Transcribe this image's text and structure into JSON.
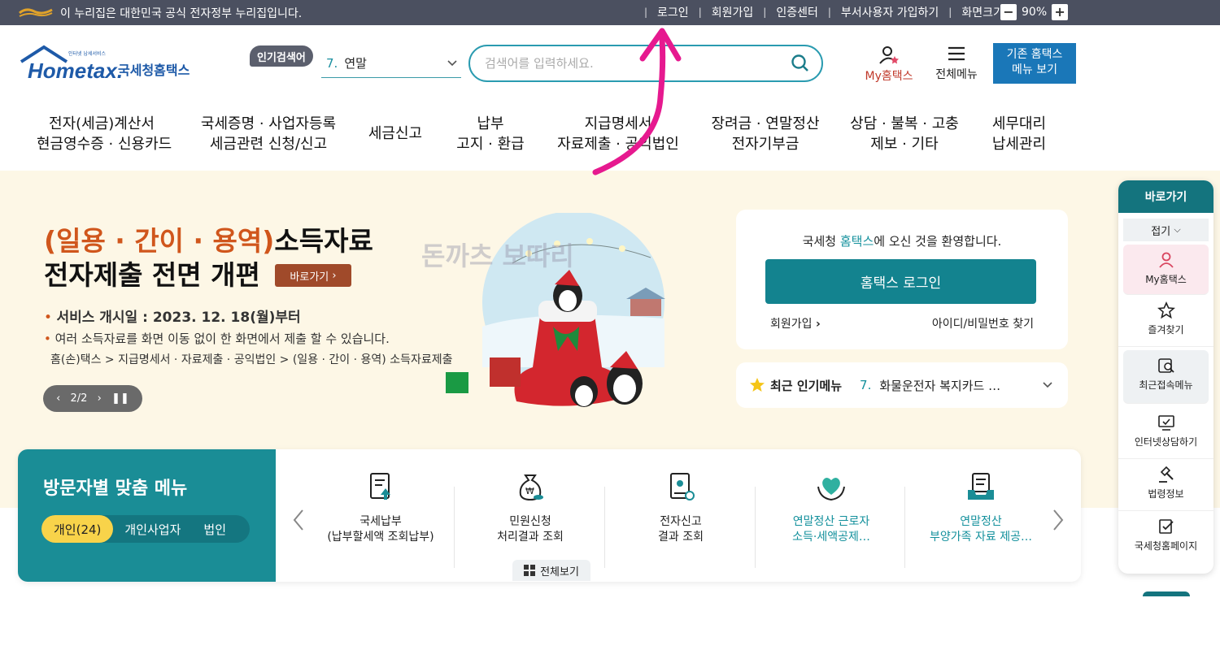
{
  "gov_bar": {
    "notice": "이 누리집은 대한민국 공식 전자정부 누리집입니다.",
    "links": [
      "로그인",
      "회원가입",
      "인증센터",
      "부서사용자 가입하기",
      "화면크기"
    ],
    "zoom": "90%",
    "zoom_out": "−",
    "zoom_in": "+"
  },
  "header": {
    "logo_small": "인터넷 납세서비스",
    "logo_word": "Hometax.",
    "logo_name": "국세청홈택스",
    "popular_badge": "인기검색어",
    "popular_rank": "7.",
    "popular_term": "연말",
    "search_placeholder": "검색어를 입력하세요.",
    "my_hometax": "My홈택스",
    "all_menu": "전체메뉴",
    "old_menu_line1": "기존 홈택스",
    "old_menu_line2": "메뉴 보기"
  },
  "gnb": [
    {
      "line1": "전자(세금)계산서",
      "line2": "현금영수증 · 신용카드"
    },
    {
      "line1": "국세증명 · 사업자등록",
      "line2": "세금관련 신청/신고"
    },
    {
      "line1": "세금신고",
      "line2": ""
    },
    {
      "line1": "납부",
      "line2": "고지 · 환급"
    },
    {
      "line1": "지급명세서",
      "line2": "자료제출 · 공익법인"
    },
    {
      "line1": "장려금 · 연말정산",
      "line2": "전자기부금"
    },
    {
      "line1": "상담 · 불복 · 고충",
      "line2": "제보 · 기타"
    },
    {
      "line1": "세무대리",
      "line2": "납세관리"
    }
  ],
  "hero": {
    "title_accent": "(일용 · 간이 · 용역)",
    "title_rest": "소득자료",
    "title_line2": "전자제출 전면 개편",
    "go_button": "바로가기",
    "date_line": "서비스 개시일 : 2023. 12. 18(월)부터",
    "desc_line": "여러 소득자료를 화면 이동 없이 한 화면에서 제출 할 수 있습니다.",
    "path_line": "홈(손)택스 > 지급명세서 · 자료제출 · 공익법인 > (일용 · 간이 · 용역) 소득자료제출",
    "slide_counter": "2/2",
    "watermark": "돈까츠 보따리"
  },
  "login_card": {
    "welcome_pre": "국세청 ",
    "welcome_hl": "홈택스",
    "welcome_post": "에 오신 것을 환영합니다.",
    "login_button": "홈택스 로그인",
    "join": "회원가입",
    "find": "아이디/비밀번호 찾기"
  },
  "popular_menu": {
    "label": "최근 인기메뉴",
    "rank": "7.",
    "item": "화물운전자 복지카드 …"
  },
  "visitor": {
    "title": "방문자별 맞춤 메뉴",
    "tabs": [
      "개인(24)",
      "개인사업자",
      "법인"
    ],
    "items": [
      {
        "line1": "국세납부",
        "line2": "(납부할세액 조회납부)",
        "icon": "tax-payment-icon"
      },
      {
        "line1": "민원신청",
        "line2": "처리결과 조회",
        "icon": "money-bag-icon"
      },
      {
        "line1": "전자신고",
        "line2": "결과 조회",
        "icon": "e-filing-icon"
      },
      {
        "line1": "연말정산 근로자",
        "line2": "소득·세액공제…",
        "icon": "heart-hands-icon"
      },
      {
        "line1": "연말정산",
        "line2": "부양가족 자료 제공…",
        "icon": "document-tray-icon"
      }
    ],
    "all_view": "전체보기"
  },
  "quick_menu": {
    "title": "바로가기",
    "fold": "접기",
    "items": [
      "My홈택스",
      "즐겨찾기",
      "최근접속메뉴",
      "인터넷상담하기",
      "법령정보",
      "국세청홈페이지"
    ]
  },
  "colors": {
    "gov_bar": "#4b5060",
    "brand_teal": "#13838f",
    "brand_blue": "#1a77b8",
    "hero_bg": "#fdf7e6",
    "accent_orange": "#d0561c",
    "annotation_pink": "#e6198f"
  }
}
